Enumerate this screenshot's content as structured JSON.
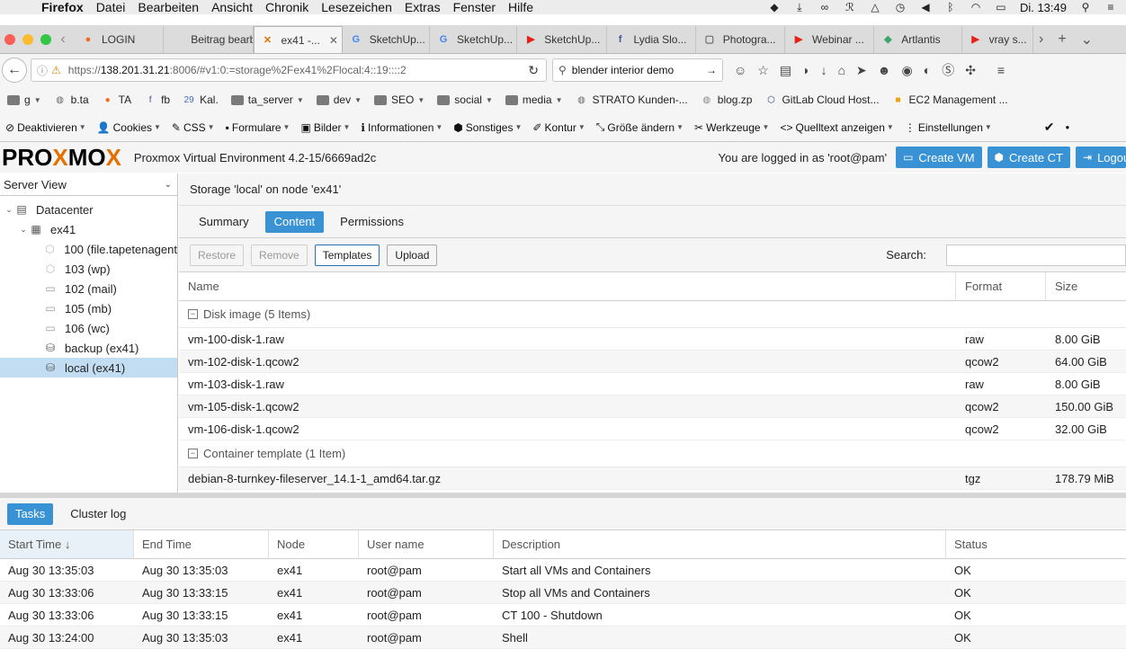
{
  "menubar": {
    "app": "Firefox",
    "items": [
      "Datei",
      "Bearbeiten",
      "Ansicht",
      "Chronik",
      "Lesezeichen",
      "Extras",
      "Fenster",
      "Hilfe"
    ],
    "clock": "Di. 13:49"
  },
  "tabs": [
    {
      "label": "LOGIN",
      "icon": "orange-circle-icon"
    },
    {
      "label": "Beitrag bearb...",
      "icon": ""
    },
    {
      "label": "ex41 -...",
      "icon": "proxmox-x-icon",
      "active": true
    },
    {
      "label": "SketchUp...",
      "icon": "google-icon"
    },
    {
      "label": "SketchUp...",
      "icon": "google-icon"
    },
    {
      "label": "SketchUp...",
      "icon": "youtube-icon"
    },
    {
      "label": "Lydia Slo...",
      "icon": "facebook-icon"
    },
    {
      "label": "Photogra...",
      "icon": "cds-icon"
    },
    {
      "label": "Webinar ...",
      "icon": "youtube-icon"
    },
    {
      "label": "Artlantis",
      "icon": "gem-icon"
    },
    {
      "label": "vray s...",
      "icon": "youtube-icon"
    }
  ],
  "navbar": {
    "url_prefix": "https://",
    "url_host": "138.201.31.21",
    "url_rest": ":8006/#v1:0:=storage%2Fex41%2Flocal:4::19::::2",
    "search_value": "blender interior demo"
  },
  "bookmarks": [
    {
      "label": "g",
      "dropdown": true
    },
    {
      "label": "b.ta"
    },
    {
      "label": "TA"
    },
    {
      "label": "fb"
    },
    {
      "label": "Kal."
    },
    {
      "label": "ta_server",
      "dropdown": true
    },
    {
      "label": "dev",
      "dropdown": true
    },
    {
      "label": "SEO",
      "dropdown": true
    },
    {
      "label": "social",
      "dropdown": true
    },
    {
      "label": "media",
      "dropdown": true
    },
    {
      "label": "STRATO Kunden-..."
    },
    {
      "label": "blog.zp"
    },
    {
      "label": "GitLab Cloud Host..."
    },
    {
      "label": "EC2 Management ..."
    }
  ],
  "devbar": [
    {
      "label": "Deaktivieren",
      "icon": "⊘"
    },
    {
      "label": "Cookies",
      "icon": "👤"
    },
    {
      "label": "CSS",
      "icon": "✎"
    },
    {
      "label": "Formulare",
      "icon": "▪"
    },
    {
      "label": "Bilder",
      "icon": "▣"
    },
    {
      "label": "Informationen",
      "icon": "ℹ"
    },
    {
      "label": "Sonstiges",
      "icon": "⬢"
    },
    {
      "label": "Kontur",
      "icon": "✐"
    },
    {
      "label": "Größe ändern",
      "icon": "⤡"
    },
    {
      "label": "Werkzeuge",
      "icon": "✂"
    },
    {
      "label": "Quelltext anzeigen",
      "icon": "<>"
    },
    {
      "label": "Einstellungen",
      "icon": "⋮"
    }
  ],
  "pve": {
    "logo_pre": "PRO",
    "logo_x": "X",
    "logo_mid": "MO",
    "logo_x2": "X",
    "version": "Proxmox Virtual Environment 4.2-15/6669ad2c",
    "logged_in": "You are logged in as 'root@pam'",
    "create_vm": "Create VM",
    "create_ct": "Create CT",
    "logout": "Logout"
  },
  "tree": {
    "view": "Server View",
    "nodes": [
      {
        "label": "Datacenter",
        "level": 0,
        "icon": "datacenter-icon"
      },
      {
        "label": "ex41",
        "level": 1,
        "icon": "server-icon"
      },
      {
        "label": "100 (file.tapetenagent",
        "level": 2,
        "icon": "container-icon"
      },
      {
        "label": "103 (wp)",
        "level": 2,
        "icon": "container-icon"
      },
      {
        "label": "102 (mail)",
        "level": 2,
        "icon": "vm-icon"
      },
      {
        "label": "105 (mb)",
        "level": 2,
        "icon": "vm-icon"
      },
      {
        "label": "106 (wc)",
        "level": 2,
        "icon": "vm-icon"
      },
      {
        "label": "backup (ex41)",
        "level": 2,
        "icon": "storage-icon"
      },
      {
        "label": "local (ex41)",
        "level": 2,
        "icon": "storage-icon",
        "selected": true
      }
    ]
  },
  "content": {
    "title": "Storage 'local' on node 'ex41'",
    "tabs": [
      "Summary",
      "Content",
      "Permissions"
    ],
    "active_tab": "Content",
    "toolbar": {
      "restore": "Restore",
      "remove": "Remove",
      "templates": "Templates",
      "upload": "Upload",
      "search_label": "Search:"
    },
    "columns": [
      "Name",
      "Format",
      "Size"
    ],
    "groups": [
      {
        "title": "Disk image (5 Items)",
        "rows": [
          {
            "name": "vm-100-disk-1.raw",
            "format": "raw",
            "size": "8.00 GiB"
          },
          {
            "name": "vm-102-disk-1.qcow2",
            "format": "qcow2",
            "size": "64.00 GiB"
          },
          {
            "name": "vm-103-disk-1.raw",
            "format": "raw",
            "size": "8.00 GiB"
          },
          {
            "name": "vm-105-disk-1.qcow2",
            "format": "qcow2",
            "size": "150.00 GiB"
          },
          {
            "name": "vm-106-disk-1.qcow2",
            "format": "qcow2",
            "size": "32.00 GiB"
          }
        ]
      },
      {
        "title": "Container template (1 Item)",
        "rows": [
          {
            "name": "debian-8-turnkey-fileserver_14.1-1_amd64.tar.gz",
            "format": "tgz",
            "size": "178.79 MiB"
          }
        ]
      }
    ]
  },
  "tasks": {
    "tabs": [
      "Tasks",
      "Cluster log"
    ],
    "columns": [
      "Start Time",
      "End Time",
      "Node",
      "User name",
      "Description",
      "Status"
    ],
    "sort_indicator": "↓",
    "rows": [
      {
        "start": "Aug 30 13:35:03",
        "end": "Aug 30 13:35:03",
        "node": "ex41",
        "user": "root@pam",
        "desc": "Start all VMs and Containers",
        "status": "OK"
      },
      {
        "start": "Aug 30 13:33:06",
        "end": "Aug 30 13:33:15",
        "node": "ex41",
        "user": "root@pam",
        "desc": "Stop all VMs and Containers",
        "status": "OK"
      },
      {
        "start": "Aug 30 13:33:06",
        "end": "Aug 30 13:33:15",
        "node": "ex41",
        "user": "root@pam",
        "desc": "CT 100 - Shutdown",
        "status": "OK"
      },
      {
        "start": "Aug 30 13:24:00",
        "end": "Aug 30 13:35:03",
        "node": "ex41",
        "user": "root@pam",
        "desc": "Shell",
        "status": "OK"
      }
    ]
  },
  "colors": {
    "accent": "#3892d4",
    "logo_x": "#e57000",
    "selection": "#c2ddf2"
  }
}
